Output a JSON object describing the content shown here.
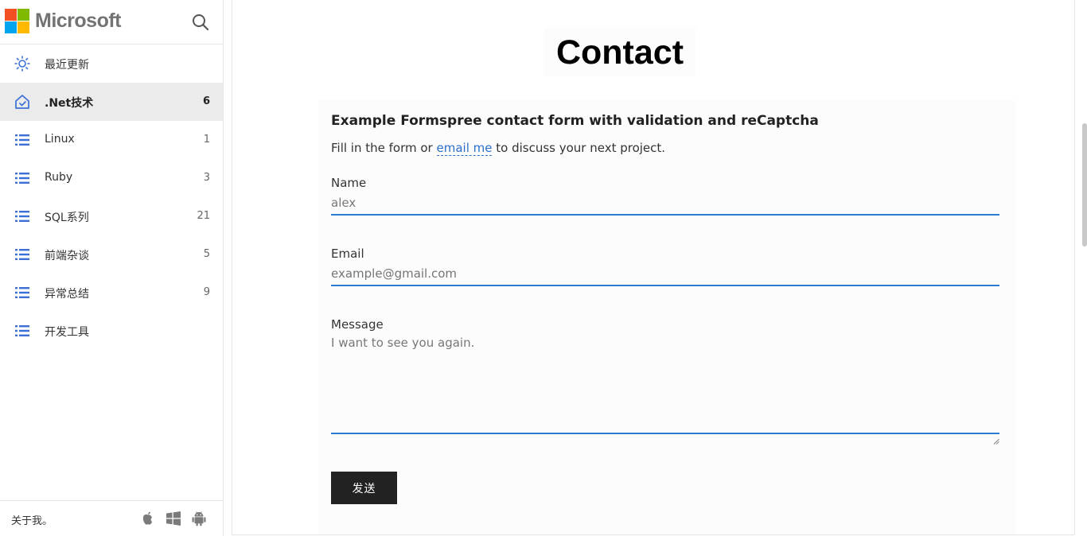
{
  "brand": {
    "name": "Microsoft",
    "search_icon": "search-icon"
  },
  "nav": {
    "items": [
      {
        "label": "最近更新",
        "count": "",
        "icon": "sun-icon"
      },
      {
        "label": ".Net技术",
        "count": "6",
        "icon": "home-icon",
        "active": true
      },
      {
        "label": "Linux",
        "count": "1",
        "icon": "list-icon"
      },
      {
        "label": "Ruby",
        "count": "3",
        "icon": "list-icon"
      },
      {
        "label": "SQL系列",
        "count": "21",
        "icon": "list-icon"
      },
      {
        "label": "前端杂谈",
        "count": "5",
        "icon": "list-icon"
      },
      {
        "label": "异常总结",
        "count": "9",
        "icon": "list-icon"
      },
      {
        "label": "开发工具",
        "count": "",
        "icon": "list-icon"
      }
    ]
  },
  "footer": {
    "about": "关于我。",
    "icons": [
      "apple-icon",
      "windows-icon",
      "android-icon"
    ]
  },
  "page": {
    "title": "Contact",
    "form": {
      "title": "Example Formspree contact form with validation and reCaptcha",
      "desc_before": "Fill in the form or ",
      "desc_link": "email me",
      "desc_after": " to discuss your next project.",
      "name_label": "Name",
      "name_value": "alex",
      "email_label": "Email",
      "email_placeholder": "example@gmail.com",
      "message_label": "Message",
      "message_value": "I want to see you again.",
      "submit_label": "发送"
    }
  },
  "colors": {
    "accent": "#2b7bd0",
    "nav_icon": "#3b6fd6",
    "active_bg": "#ebebeb",
    "button_bg": "#222222"
  }
}
